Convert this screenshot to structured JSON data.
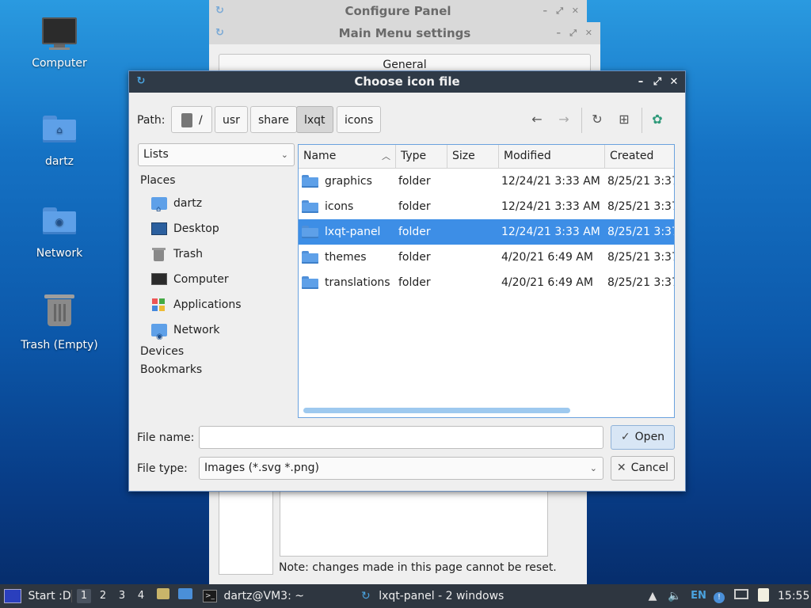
{
  "desktop": {
    "icons": [
      {
        "label": "Computer",
        "icon": "computer-icon"
      },
      {
        "label": "dartz",
        "icon": "home-folder-icon"
      },
      {
        "label": "Network",
        "icon": "network-folder-icon"
      },
      {
        "label": "Trash (Empty)",
        "icon": "trash-icon"
      }
    ]
  },
  "background_windows": {
    "configure_panel_title": "Configure Panel",
    "main_menu_title": "Main Menu settings",
    "general_tab": "General",
    "note": "Note: changes made in this page cannot be reset."
  },
  "dialog": {
    "title": "Choose icon file",
    "path_label": "Path:",
    "crumbs": [
      "/",
      "usr",
      "share",
      "lxqt",
      "icons"
    ],
    "active_crumb": "lxqt",
    "view_combo": "Lists",
    "places_heading": "Places",
    "places": [
      {
        "label": "dartz",
        "icon": "home-folder-icon"
      },
      {
        "label": "Desktop",
        "icon": "desktop-icon"
      },
      {
        "label": "Trash",
        "icon": "trash-icon"
      },
      {
        "label": "Computer",
        "icon": "computer-icon"
      },
      {
        "label": "Applications",
        "icon": "applications-icon"
      },
      {
        "label": "Network",
        "icon": "network-folder-icon"
      }
    ],
    "devices_heading": "Devices",
    "bookmarks_heading": "Bookmarks",
    "columns": [
      "Name",
      "Type",
      "Size",
      "Modified",
      "Created"
    ],
    "files": [
      {
        "name": "graphics",
        "type": "folder",
        "size": "",
        "modified": "12/24/21 3:33 AM",
        "created": "8/25/21 3:37"
      },
      {
        "name": "icons",
        "type": "folder",
        "size": "",
        "modified": "12/24/21 3:33 AM",
        "created": "8/25/21 3:37"
      },
      {
        "name": "lxqt-panel",
        "type": "folder",
        "size": "",
        "modified": "12/24/21 3:33 AM",
        "created": "8/25/21 3:37"
      },
      {
        "name": "themes",
        "type": "folder",
        "size": "",
        "modified": "4/20/21 6:49 AM",
        "created": "8/25/21 3:37"
      },
      {
        "name": "translations",
        "type": "folder",
        "size": "",
        "modified": "4/20/21 6:49 AM",
        "created": "8/25/21 3:37"
      }
    ],
    "selected_file": "lxqt-panel",
    "file_name_label": "File name:",
    "file_name_value": "",
    "file_type_label": "File type:",
    "file_type_value": "Images (*.svg *.png)",
    "open_button": "Open",
    "cancel_button": "Cancel"
  },
  "taskbar": {
    "start_label": "Start :D",
    "workspaces": [
      "1",
      "2",
      "3",
      "4"
    ],
    "active_workspace": "1",
    "terminal_task": "dartz@VM3: ~",
    "panel_task": "lxqt-panel - 2 windows",
    "keyboard_layout": "EN",
    "clock": "15:55"
  },
  "colors": {
    "selection": "#3d8ee6",
    "titlebar": "#2f3a47",
    "taskbar": "#2e3640",
    "folder": "#5ea0e8"
  }
}
